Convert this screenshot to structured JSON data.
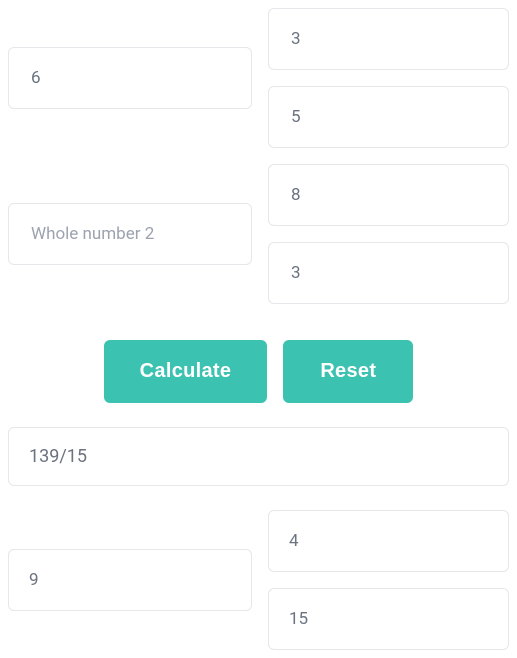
{
  "fraction1": {
    "whole": "6",
    "numerator": "3",
    "denominator": "5"
  },
  "fraction2": {
    "whole_placeholder": "Whole number 2",
    "whole": "",
    "numerator": "8",
    "denominator": "3"
  },
  "buttons": {
    "calculate": "Calculate",
    "reset": "Reset"
  },
  "result": {
    "improper": "139/15",
    "whole": "9",
    "numerator": "4",
    "denominator": "15"
  }
}
